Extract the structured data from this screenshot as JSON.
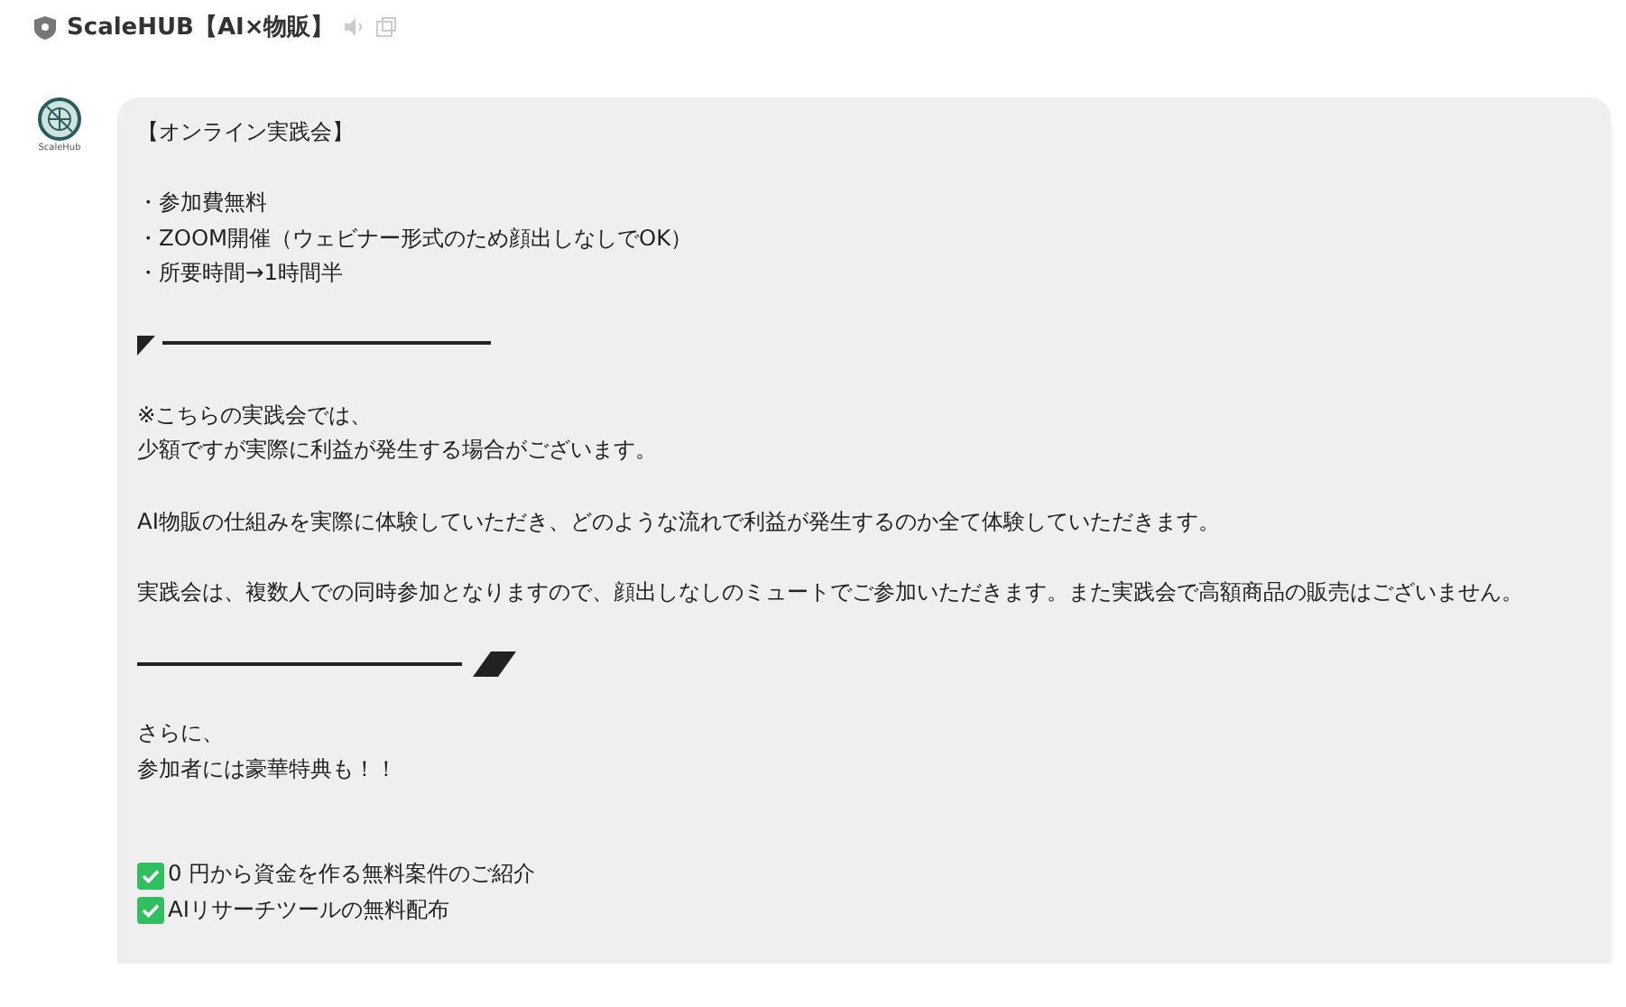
{
  "channel": {
    "title": "ScaleHUB【AI×物販】"
  },
  "message": {
    "avatar_label": "ScaleHub",
    "lines": [
      {
        "kind": "text",
        "text": "【オンライン実践会】"
      },
      {
        "kind": "blank"
      },
      {
        "kind": "text",
        "text": "・参加費無料"
      },
      {
        "kind": "text",
        "text": "・ZOOM開催（ウェビナー形式のため顔出しなしでOK）"
      },
      {
        "kind": "text",
        "text": "・所要時間→1時間半"
      },
      {
        "kind": "blank"
      },
      {
        "kind": "divider_start"
      },
      {
        "kind": "blank"
      },
      {
        "kind": "text",
        "text": "※こちらの実践会では、"
      },
      {
        "kind": "text",
        "text": "少額ですが実際に利益が発生する場合がございます。"
      },
      {
        "kind": "blank"
      },
      {
        "kind": "text",
        "text": "AI物販の仕組みを実際に体験していただき、どのような流れで利益が発生するのか全て体験していただきます。"
      },
      {
        "kind": "blank"
      },
      {
        "kind": "text",
        "text": "実践会は、複数人での同時参加となりますので、顔出しなしのミュートでご参加いただきます。また実践会で高額商品の販売はございません。"
      },
      {
        "kind": "blank"
      },
      {
        "kind": "divider_end"
      },
      {
        "kind": "blank"
      },
      {
        "kind": "text",
        "text": "さらに、"
      },
      {
        "kind": "text",
        "text": "参加者には豪華特典も！！"
      },
      {
        "kind": "blank"
      },
      {
        "kind": "blank"
      },
      {
        "kind": "check",
        "text": " 0 円から資金を作る無料案件のご紹介"
      },
      {
        "kind": "check",
        "text": "AIリサーチツールの無料配布"
      }
    ]
  }
}
